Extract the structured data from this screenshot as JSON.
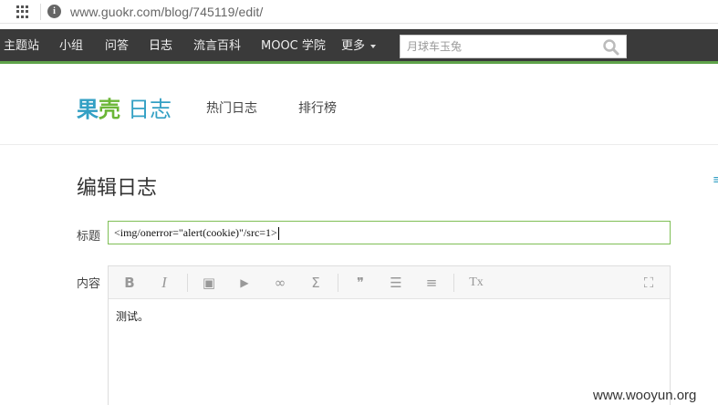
{
  "browser": {
    "url": "www.guokr.com/blog/745119/edit/",
    "apps_icon": "apps-grid-icon",
    "info_icon": "info-icon",
    "info_glyph": "i"
  },
  "topnav": {
    "items": [
      {
        "label": "主题站"
      },
      {
        "label": "小组"
      },
      {
        "label": "问答"
      },
      {
        "label": "日志"
      },
      {
        "label": "流言百科"
      },
      {
        "label": "MOOC 学院"
      },
      {
        "label": "更多"
      }
    ],
    "active": "日志",
    "accent_color": "#5fa34a",
    "search_placeholder": "月球车玉兔",
    "search_icon": "search-icon"
  },
  "header": {
    "logo_part1": "果",
    "logo_part2": "壳",
    "logo_part3": "日志",
    "nav": [
      {
        "label": "热门日志"
      },
      {
        "label": "排行榜"
      }
    ]
  },
  "form": {
    "page_title": "编辑日志",
    "side_mark": "≡",
    "title_label": "标题",
    "title_value": "<img/onerror=\"alert(cookie)\"/src=1>",
    "content_label": "内容",
    "toolbar": [
      {
        "name": "bold-icon",
        "glyph": "B"
      },
      {
        "name": "italic-icon",
        "glyph": "I"
      },
      {
        "name": "image-icon",
        "glyph": "▣"
      },
      {
        "name": "video-icon",
        "glyph": "▶"
      },
      {
        "name": "link-icon",
        "glyph": "∞"
      },
      {
        "name": "formula-icon",
        "glyph": "Σ"
      },
      {
        "name": "quote-icon",
        "glyph": "❞"
      },
      {
        "name": "bullet-list-icon",
        "glyph": "☰"
      },
      {
        "name": "numbered-list-icon",
        "glyph": "≡"
      },
      {
        "name": "clear-format-icon",
        "glyph": "Tx"
      },
      {
        "name": "fullscreen-icon",
        "glyph": "⛶"
      }
    ],
    "content_text": "测试。"
  },
  "watermark": "www.wooyun.org"
}
